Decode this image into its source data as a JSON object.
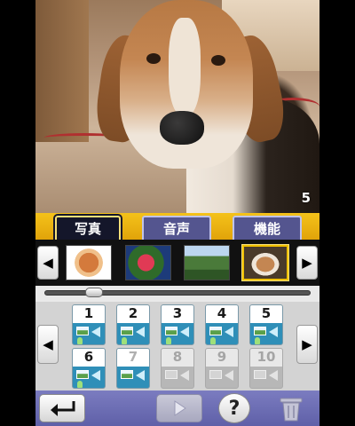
{
  "preview": {
    "counter": "5"
  },
  "tabs": [
    {
      "label": "写真",
      "active": true
    },
    {
      "label": "音声",
      "active": false
    },
    {
      "label": "機能",
      "active": false
    }
  ],
  "thumbnails": {
    "items": [
      {
        "subject": "food"
      },
      {
        "subject": "flowers"
      },
      {
        "subject": "mountains"
      },
      {
        "subject": "dog",
        "selected": true
      }
    ],
    "slider_position": 0.18
  },
  "slots": [
    {
      "num": "1",
      "enabled": true
    },
    {
      "num": "2",
      "enabled": true
    },
    {
      "num": "3",
      "enabled": true
    },
    {
      "num": "4",
      "enabled": true
    },
    {
      "num": "5",
      "enabled": true
    },
    {
      "num": "6",
      "enabled": true
    },
    {
      "num": "7",
      "enabled": true
    },
    {
      "num": "8",
      "enabled": false
    },
    {
      "num": "9",
      "enabled": false
    },
    {
      "num": "10",
      "enabled": false
    }
  ],
  "toolbar": {
    "back_icon": "back-arrow-icon",
    "play_icon": "play-icon",
    "help_label": "?",
    "trash_icon": "trash-icon"
  },
  "colors": {
    "tab_bar": "#e8b010",
    "slot_blue": "#2f8fb8",
    "toolbar_purple": "#6a6bb3"
  }
}
